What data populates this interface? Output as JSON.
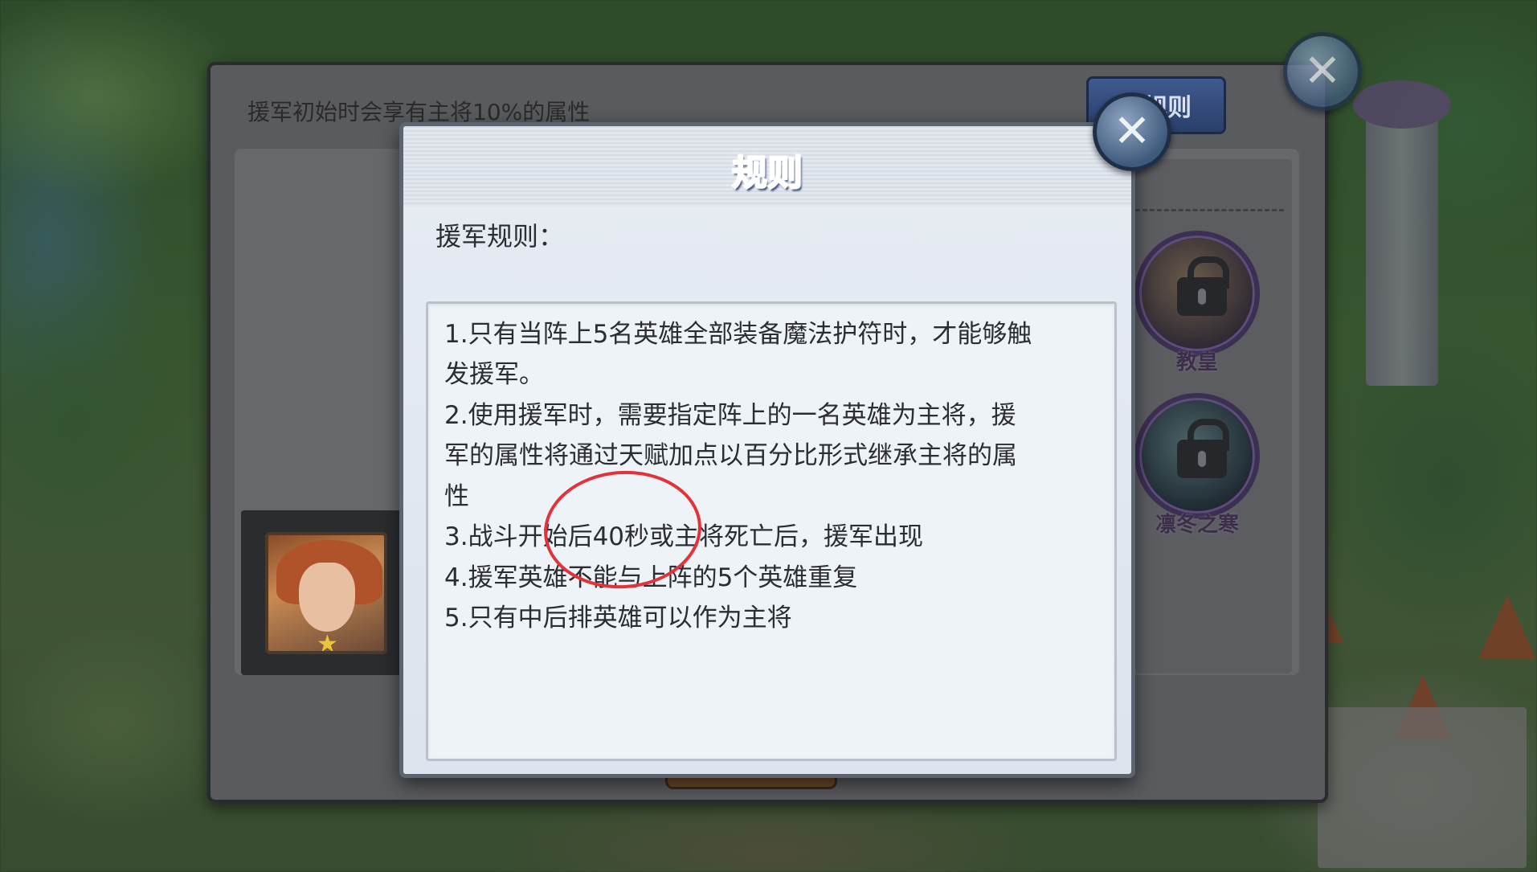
{
  "background": {
    "description_colors": {
      "grass": "#4d7a3b",
      "tower": "#c9c0d8",
      "roof": "#b5532e"
    }
  },
  "outer_panel": {
    "info_text": "援军初始时会享有主将10%的属性",
    "tab_button_label": "规则",
    "close_icon": "close-icon",
    "locked_heroes": [
      {
        "name": "教皇",
        "icon": "lock-icon"
      },
      {
        "name": "凛冬之寒",
        "icon": "lock-icon"
      }
    ],
    "selected_hero_star": "★"
  },
  "rules_dialog": {
    "title": "规则",
    "subtitle": "援军规则：",
    "close_icon": "close-icon",
    "lines": [
      "1.只有当阵上5名英雄全部装备魔法护符时，才能够触",
      "发援军。",
      "2.使用援军时，需要指定阵上的一名英雄为主将，援",
      "军的属性将通过天赋加点以百分比形式继承主将的属",
      "性",
      "3.战斗开始后40秒或主将死亡后，援军出现",
      "4.援军英雄不能与上阵的5个英雄重复",
      "5.只有中后排英雄可以作为主将"
    ],
    "colors": {
      "title": "#3a5fa8",
      "text": "#2b2d33",
      "annotation": "#e3323a"
    }
  },
  "close_glyph": "✕"
}
